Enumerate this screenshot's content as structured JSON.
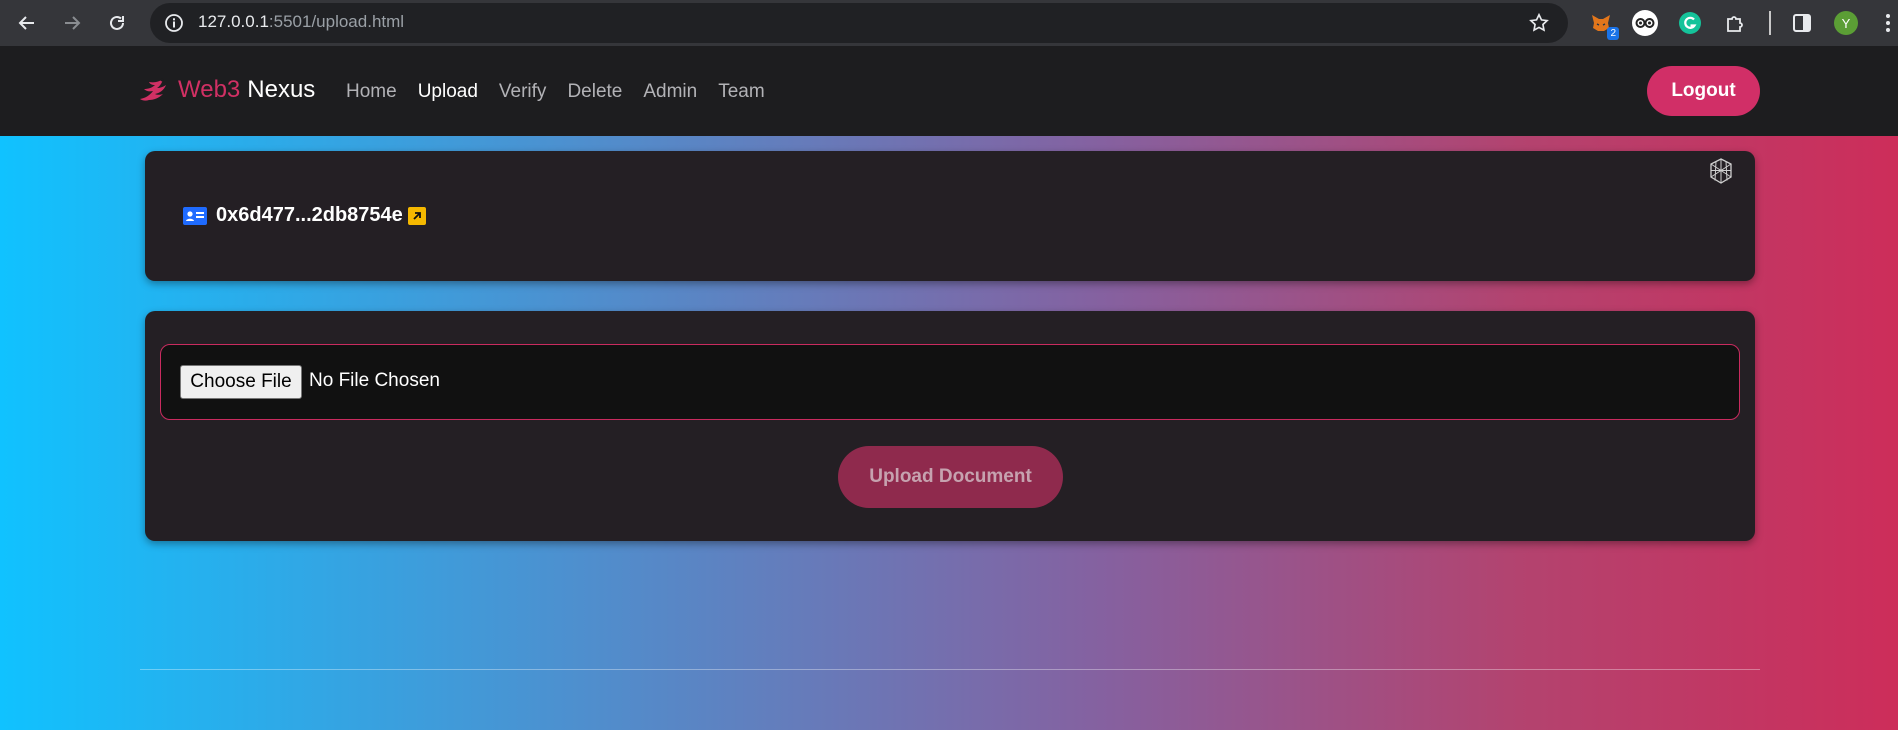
{
  "browser": {
    "url_host": "127.0.0.1",
    "url_path": ":5501/upload.html",
    "extensions": [
      {
        "name": "metamask-extension",
        "badge": "2"
      },
      {
        "name": "privacy-extension"
      },
      {
        "name": "grammarly-extension"
      },
      {
        "name": "extensions-puzzle"
      }
    ],
    "profile_initial": "Y"
  },
  "header": {
    "brand_web3": "Web3",
    "brand_nexus": "Nexus",
    "nav": [
      {
        "label": "Home"
      },
      {
        "label": "Upload",
        "active": true
      },
      {
        "label": "Verify"
      },
      {
        "label": "Delete"
      },
      {
        "label": "Admin"
      },
      {
        "label": "Team"
      }
    ],
    "logout_label": "Logout"
  },
  "wallet": {
    "address": "0x6d477...2db8754e",
    "icon": "id-card-icon",
    "link_icon": "external-link-icon",
    "network_icon": "globe-network-icon"
  },
  "upload": {
    "choose_label": "Choose File",
    "status": "No File Chosen",
    "button_label": "Upload Document"
  },
  "colors": {
    "accent": "#d12f67",
    "card_bg": "#241f24",
    "gradient_start": "#10c2ff",
    "gradient_end": "#cd2d5a"
  }
}
